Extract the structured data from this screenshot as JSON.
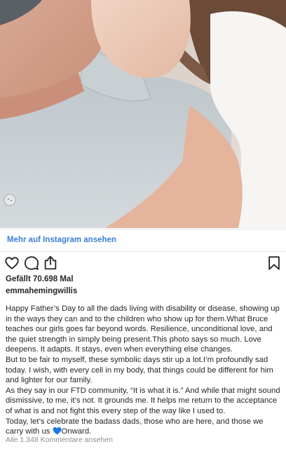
{
  "post": {
    "more_link": "Mehr auf Instagram ansehen",
    "likes_text": "Gefällt 70.698 Mal",
    "username": "emmahemingwillis",
    "caption": {
      "p1": "Happy Father’s Day to all the dads living with disability or disease, showing up in the ways they can and to the children who show up for them.What Bruce teaches our girls goes far beyond words. Resilience, unconditional love, and the quiet strength in simply being present.This photo says so much. Love deepens. It adapts. It stays, even when everything else changes.",
      "p2": "But to be fair to myself, these symbolic days stir up a lot.I’m profoundly sad today. I wish, with every cell in my body, that things could be different for him and lighter for our family.",
      "p3": "As they say in our FTD community, “It is what it is.” And while that might sound dismissive, to me, it’s not. It grounds me. It helps me return to the acceptance of what is and not fight this every step of the way like I used to.",
      "p4_before": "Today, let’s celebrate the badass dads, those who are here, and those we carry with us ",
      "p4_after": "Onward."
    },
    "comments_link": "Alle 1.348 Kommentare ansehen"
  },
  "icons": {
    "like": "heart-outline-icon",
    "comment": "speech-bubble-icon",
    "share": "share-icon",
    "save": "bookmark-icon",
    "caption_emoji": "blue-heart-icon"
  },
  "colors": {
    "link": "#3a7fd5",
    "text": "#262626",
    "muted": "#8e8e8e",
    "blue_heart": "#1f7ae0"
  }
}
